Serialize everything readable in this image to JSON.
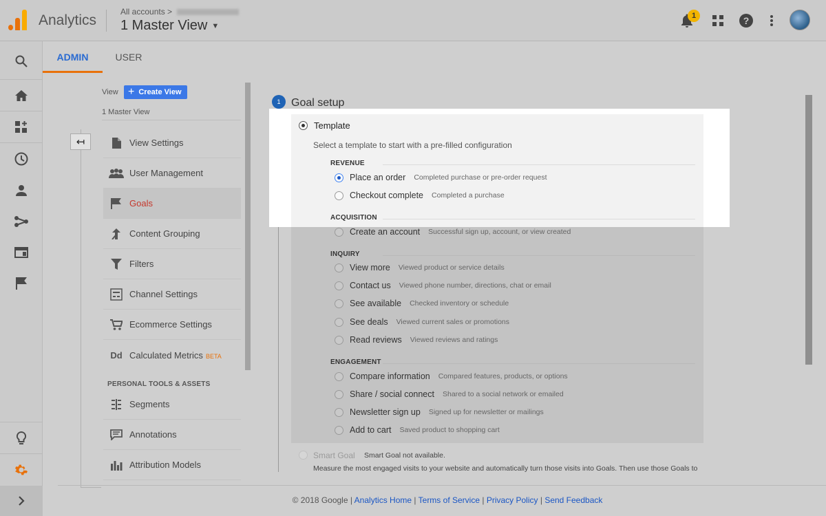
{
  "header": {
    "app_name": "Analytics",
    "breadcrumb": "All accounts",
    "breadcrumb_sep": ">",
    "view_name": "1 Master View",
    "notification_count": "1"
  },
  "tabs": {
    "admin": "ADMIN",
    "user": "USER"
  },
  "view_column": {
    "view_label": "View",
    "create_view": "Create View",
    "selected_view": "1 Master View",
    "items": [
      {
        "label": "View Settings"
      },
      {
        "label": "User Management"
      },
      {
        "label": "Goals"
      },
      {
        "label": "Content Grouping"
      },
      {
        "label": "Filters"
      },
      {
        "label": "Channel Settings"
      },
      {
        "label": "Ecommerce Settings"
      },
      {
        "label": "Calculated Metrics",
        "badge": "BETA"
      }
    ],
    "personal_section": "PERSONAL TOOLS & ASSETS",
    "personal_items": [
      {
        "label": "Segments"
      },
      {
        "label": "Annotations"
      },
      {
        "label": "Attribution Models"
      }
    ]
  },
  "goal_setup": {
    "step_number": "1",
    "title": "Goal setup",
    "template_label": "Template",
    "template_desc": "Select a template to start with a pre-filled configuration",
    "categories": {
      "revenue": "REVENUE",
      "acquisition": "ACQUISITION",
      "inquiry": "INQUIRY",
      "engagement": "ENGAGEMENT"
    },
    "options": {
      "place_order": {
        "label": "Place an order",
        "desc": "Completed purchase or pre-order request"
      },
      "checkout_complete": {
        "label": "Checkout complete",
        "desc": "Completed a purchase"
      },
      "create_account": {
        "label": "Create an account",
        "desc": "Successful sign up, account, or view created"
      },
      "view_more": {
        "label": "View more",
        "desc": "Viewed product or service details"
      },
      "contact_us": {
        "label": "Contact us",
        "desc": "Viewed phone number, directions, chat or email"
      },
      "see_available": {
        "label": "See available",
        "desc": "Checked inventory or schedule"
      },
      "see_deals": {
        "label": "See deals",
        "desc": "Viewed current sales or promotions"
      },
      "read_reviews": {
        "label": "Read reviews",
        "desc": "Viewed reviews and ratings"
      },
      "compare_info": {
        "label": "Compare information",
        "desc": "Compared features, products, or options"
      },
      "share_social": {
        "label": "Share / social connect",
        "desc": "Shared to a social network or emailed"
      },
      "newsletter": {
        "label": "Newsletter sign up",
        "desc": "Signed up for newsletter or mailings"
      },
      "add_to_cart": {
        "label": "Add to cart",
        "desc": "Saved product to shopping cart"
      }
    },
    "smart_goal_label": "Smart Goal",
    "smart_goal_status": "Smart Goal not available.",
    "smart_goal_desc": "Measure the most engaged visits to your website and automatically turn those visits into Goals. Then use those Goals to"
  },
  "footer": {
    "copyright": "© 2018 Google",
    "sep": "|",
    "links": [
      "Analytics Home",
      "Terms of Service",
      "Privacy Policy",
      "Send Feedback"
    ]
  },
  "colors": {
    "accent_blue": "#3b78e7",
    "active_tab_underline": "#e8710a",
    "active_menu_text": "#c5372c",
    "notification_badge": "#f2b400",
    "settings_gear": "#e8710a"
  }
}
